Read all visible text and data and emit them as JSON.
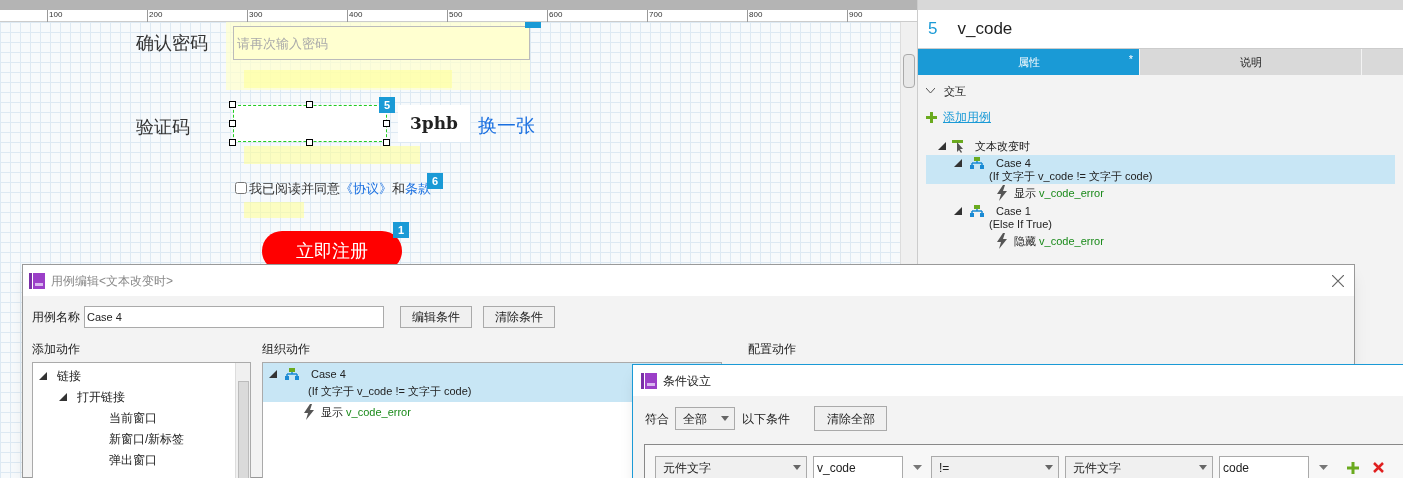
{
  "ruler": {
    "ticks": [
      "100",
      "200",
      "300",
      "400",
      "500",
      "600",
      "700",
      "800",
      "900"
    ]
  },
  "canvas": {
    "confirm_label": "确认密码",
    "confirm_placeholder": "请再次输入密码",
    "code_label": "验证码",
    "code_badge": "5",
    "captcha": "3phb",
    "refresh_link": "换一张",
    "agree": {
      "checked": false,
      "text": "我已阅读并同意",
      "link1": "《协议》",
      "and": "和",
      "link2": "条款",
      "badge": "6"
    },
    "submit": "立即注册",
    "submit_badge": "1"
  },
  "inspector": {
    "number": "5",
    "name": "v_code",
    "tabs": [
      {
        "label": "属性",
        "mark": "*",
        "selected": true
      },
      {
        "label": "说明",
        "selected": false
      }
    ],
    "section": "交互",
    "expanded": true,
    "add_case": "添加用例",
    "event": "文本改变时",
    "cases": [
      {
        "name": "Case 4",
        "condition": "(If 文字于 v_code != 文字于 code)",
        "selected": true,
        "action_verb": "显示",
        "action_target": "v_code_error"
      },
      {
        "name": "Case 1",
        "condition": "(Else If True)",
        "selected": false,
        "action_verb": "隐藏",
        "action_target": "v_code_error"
      }
    ]
  },
  "case_editor": {
    "title": "用例编辑<文本改变时>",
    "name_label": "用例名称",
    "name_value": "Case 4",
    "buttons": [
      "编辑条件",
      "清除条件"
    ],
    "add_actions_label": "添加动作",
    "organize_label": "组织动作",
    "configure_label": "配置动作",
    "actions_tree": [
      {
        "label": "链接",
        "expanded": true,
        "children": [
          {
            "label": "打开链接",
            "expanded": true,
            "children": [
              {
                "label": "当前窗口"
              },
              {
                "label": "新窗口/新标签"
              },
              {
                "label": "弹出窗口"
              }
            ]
          }
        ]
      }
    ],
    "organize": {
      "name": "Case 4",
      "condition": "(If 文字于 v_code != 文字于 code)",
      "selected": true,
      "action_verb": "显示",
      "action_target": "v_code_error"
    }
  },
  "condition_dialog": {
    "title": "条件设立",
    "match_label": "符合",
    "match_value": "全部",
    "match_suffix": "以下条件",
    "clear_all": "清除全部",
    "row": {
      "left_type": "元件文字",
      "left_value": "v_code",
      "operator": "!=",
      "right_type": "元件文字",
      "right_value": "code"
    }
  }
}
